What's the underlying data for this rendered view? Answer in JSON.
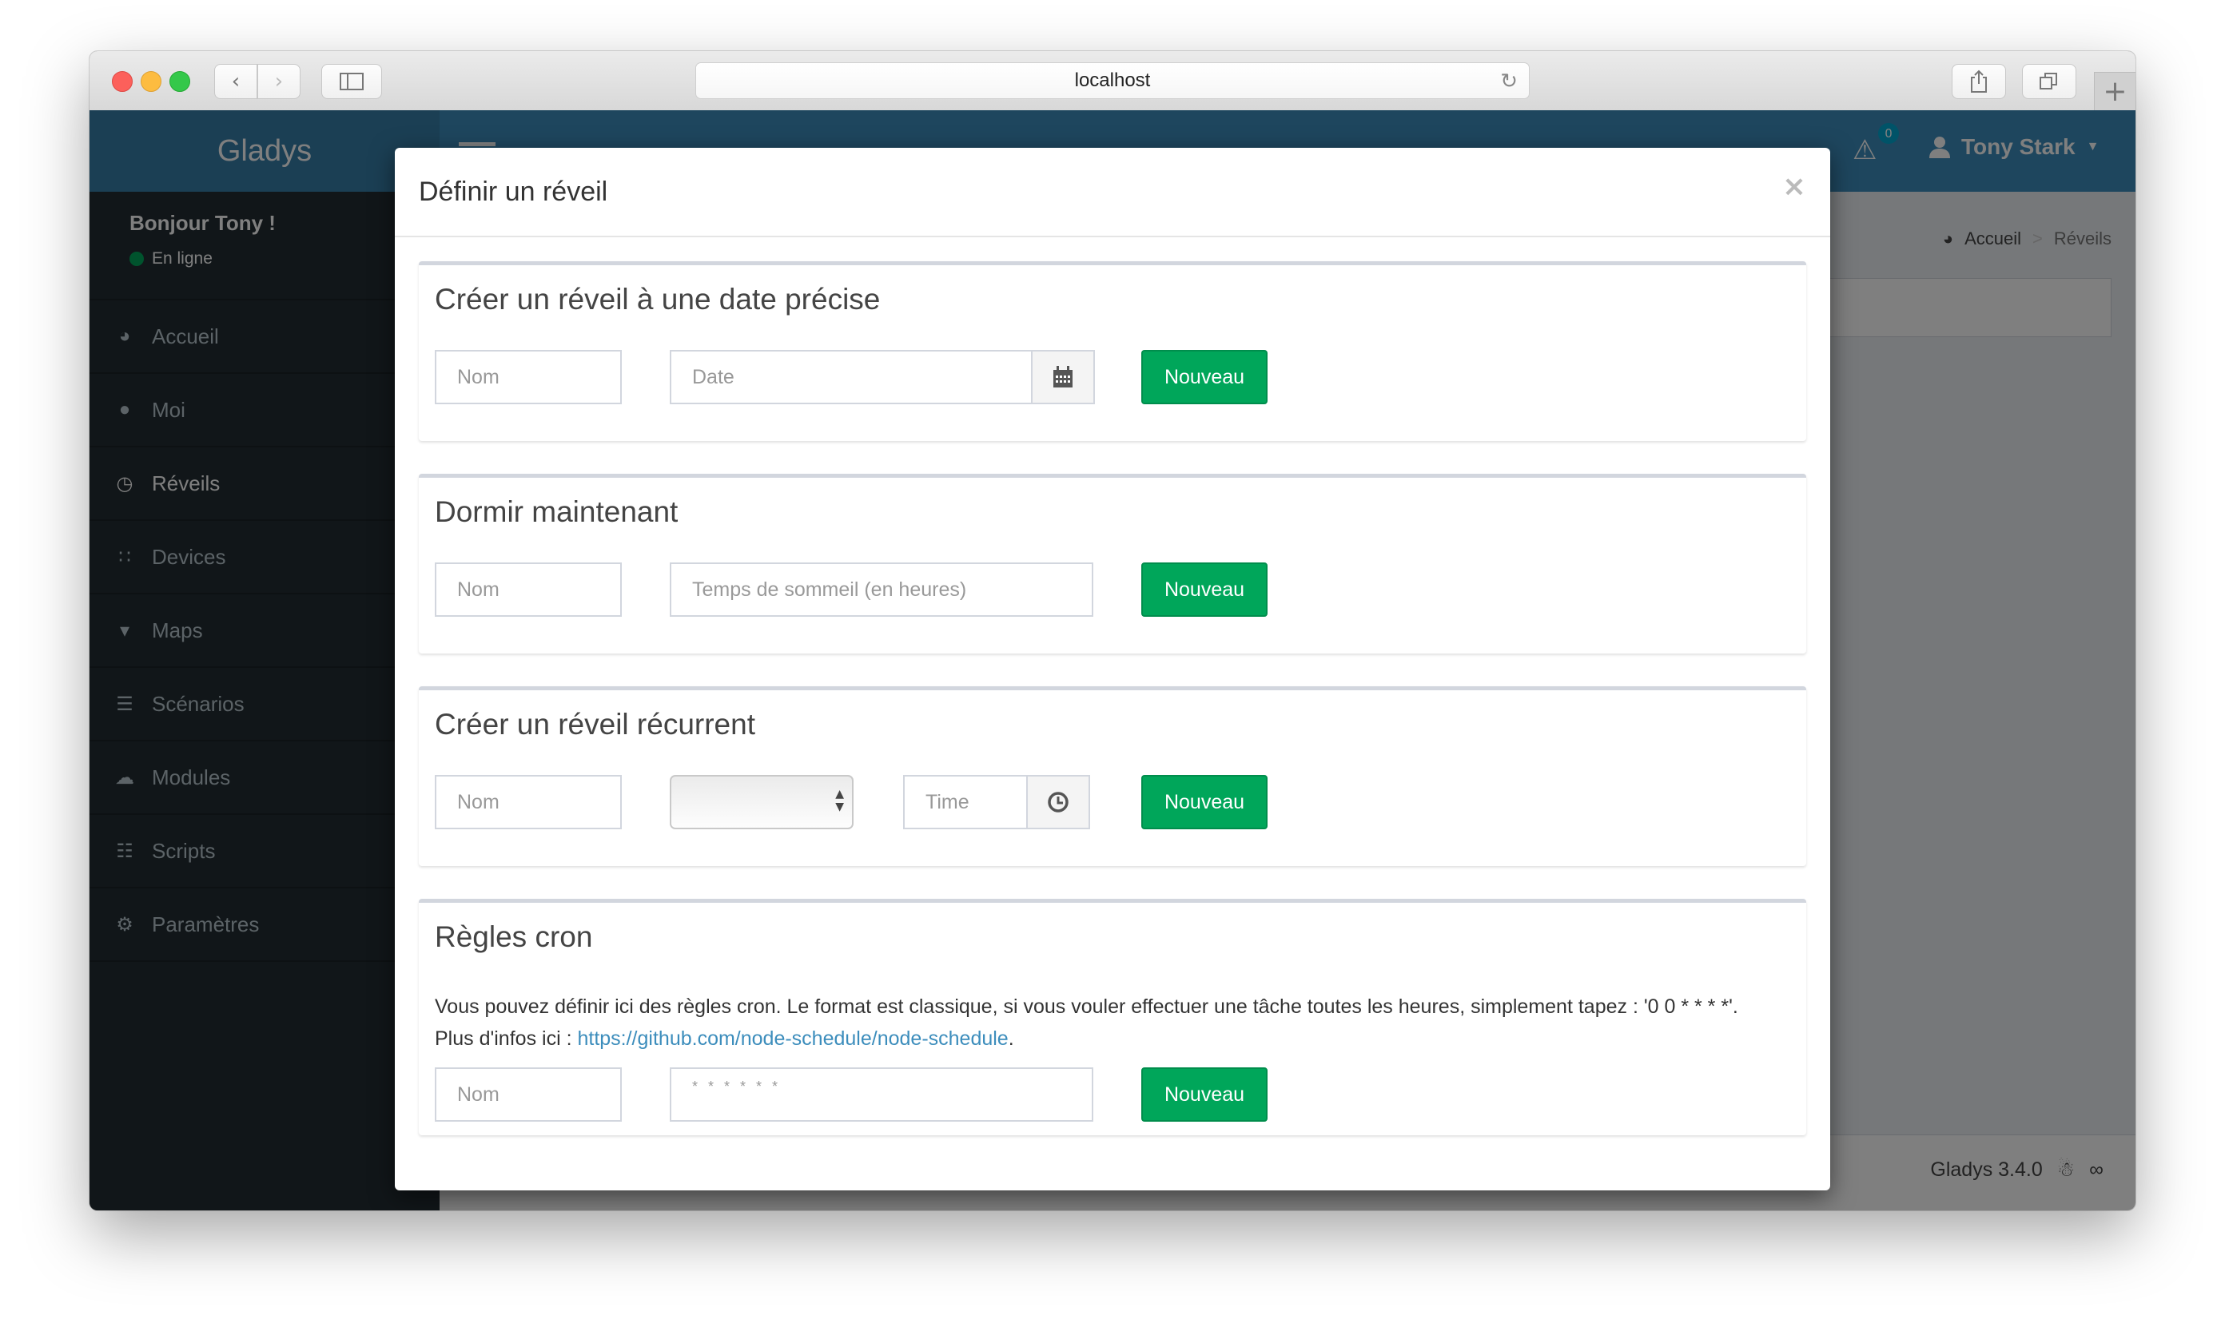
{
  "browser": {
    "url": "localhost",
    "icons": {
      "back": "chevron-left-icon",
      "forward": "chevron-right-icon",
      "sidebar": "sidebar-icon",
      "reload": "reload-icon",
      "share": "share-icon",
      "tabs": "tabs-icon",
      "new_tab": "plus-icon"
    }
  },
  "navbar": {
    "brand": "Gladys",
    "notifications_count": "0",
    "user_name": "Tony Stark"
  },
  "sidebar": {
    "greeting": "Bonjour Tony !",
    "status": "En ligne",
    "items": [
      {
        "label": "Accueil",
        "icon": "dashboard-icon"
      },
      {
        "label": "Moi",
        "icon": "user-icon"
      },
      {
        "label": "Réveils",
        "icon": "clock-icon",
        "active": true
      },
      {
        "label": "Devices",
        "icon": "rss-icon"
      },
      {
        "label": "Maps",
        "icon": "map-marker-icon"
      },
      {
        "label": "Scénarios",
        "icon": "tasks-icon"
      },
      {
        "label": "Modules",
        "icon": "cloud-download-icon"
      },
      {
        "label": "Scripts",
        "icon": "file-text-icon"
      },
      {
        "label": "Paramètres",
        "icon": "gear-icon"
      }
    ]
  },
  "breadcrumb": {
    "home": "Accueil",
    "separator": ">",
    "current": "Réveils"
  },
  "footer": {
    "version": "Gladys 3.4.0"
  },
  "modal": {
    "title": "Définir un réveil",
    "close": "×",
    "sections": [
      {
        "title": "Créer un réveil à une date précise",
        "name_placeholder": "Nom",
        "date_placeholder": "Date",
        "button": "Nouveau"
      },
      {
        "title": "Dormir maintenant",
        "name_placeholder": "Nom",
        "duration_placeholder": "Temps de sommeil (en heures)",
        "button": "Nouveau"
      },
      {
        "title": "Créer un réveil récurrent",
        "name_placeholder": "Nom",
        "day_select_value": "",
        "time_placeholder": "Time",
        "button": "Nouveau"
      },
      {
        "title": "Règles cron",
        "description": "Vous pouvez définir ici des règles cron. Le format est classique, si vous vouler effectuer une tâche toutes les heures, simplement tapez : '0 0 * * * *'.",
        "more_info_prefix": "Plus d'infos ici : ",
        "link": "https://github.com/node-schedule/node-schedule",
        "more_info_suffix": ".",
        "name_placeholder": "Nom",
        "cron_placeholder": "* * * * * *",
        "button": "Nouveau"
      }
    ]
  },
  "colors": {
    "navbar": "#3c8dbc",
    "brand": "#367fa9",
    "sidebar": "#222d32",
    "success": "#00a65a",
    "link": "#3c8dbc"
  }
}
